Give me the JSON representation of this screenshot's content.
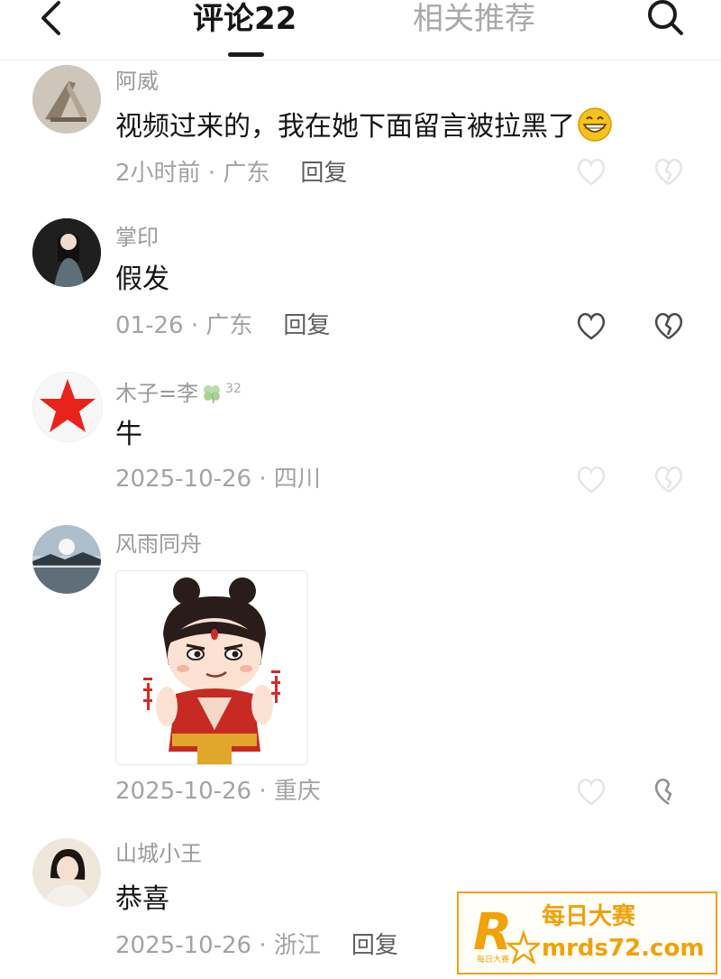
{
  "header": {
    "tab_active": "评论22",
    "tab_other": "相关推荐"
  },
  "comments": [
    {
      "user": "阿威",
      "text": "视频过来的，我在她下面留言被拉黑了",
      "emoji": "grinning-face-emoji",
      "meta": "2小时前 · 广东",
      "reply": "回复"
    },
    {
      "user": "掌印",
      "text": "假发",
      "meta": "01-26 · 广东",
      "reply": "回复"
    },
    {
      "user": "木子=李",
      "badge": "32",
      "text": "牛",
      "meta": "2025-10-26 · 四川"
    },
    {
      "user": "风雨同舟",
      "sticker": "nezha-sticker",
      "meta": "2025-10-26 · 重庆"
    },
    {
      "user": "山城小王",
      "text": "恭喜",
      "meta": "2025-10-26 · 浙江",
      "reply": "回复"
    }
  ],
  "watermark": {
    "logo": "R",
    "logo_sub": "每日大赛",
    "title": "每日大赛",
    "url": "mrds72.com"
  },
  "colors": {
    "watermark": "#f1a10a",
    "star": "#e8231c",
    "meta": "#a3a3a3"
  }
}
